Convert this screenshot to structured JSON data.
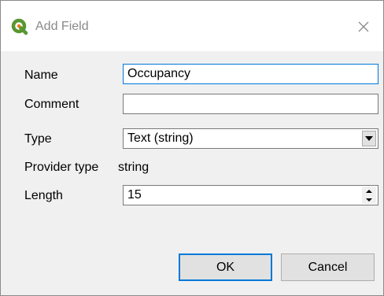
{
  "window": {
    "title": "Add Field",
    "icon": "qgis-logo-icon",
    "close_icon": "close-icon"
  },
  "form": {
    "name": {
      "label": "Name",
      "value": "Occupancy"
    },
    "comment": {
      "label": "Comment",
      "value": ""
    },
    "type": {
      "label": "Type",
      "value": "Text (string)"
    },
    "provider_type": {
      "label": "Provider type",
      "value": "string"
    },
    "length": {
      "label": "Length",
      "value": "15"
    }
  },
  "buttons": {
    "ok": "OK",
    "cancel": "Cancel"
  },
  "colors": {
    "focus": "#0078d7",
    "logo_green": "#589632",
    "logo_yellow": "#ee7913"
  }
}
